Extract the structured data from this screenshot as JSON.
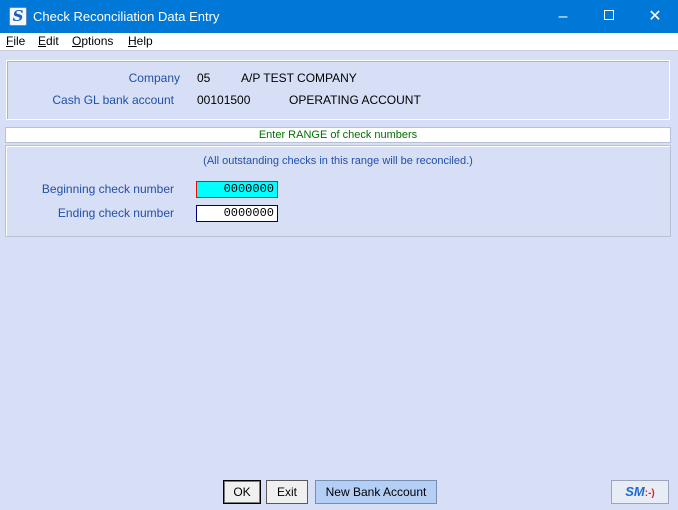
{
  "window": {
    "title": "Check Reconciliation Data Entry",
    "app_icon_letter": "S",
    "min_glyph": "–",
    "close_glyph": "✕"
  },
  "menu": {
    "items": [
      {
        "hotkey": "F",
        "rest": "ile"
      },
      {
        "hotkey": "E",
        "rest": "dit"
      },
      {
        "hotkey": "O",
        "rest": "ptions"
      },
      {
        "hotkey": "H",
        "rest": "elp"
      }
    ]
  },
  "header": {
    "company_label": "Company",
    "company_code": "05",
    "company_name": "A/P TEST COMPANY",
    "bank_label": "Cash GL bank account",
    "bank_code": "00101500",
    "bank_name": "OPERATING ACCOUNT"
  },
  "range": {
    "band_text": "Enter RANGE of check numbers",
    "note": "(All outstanding checks in this range will be reconciled.)",
    "begin_label": "Beginning check number",
    "begin_value": "0000000",
    "end_label": "Ending check number",
    "end_value": "0000000"
  },
  "buttons": {
    "ok": "OK",
    "exit": "Exit",
    "new_bank": "New Bank Account",
    "sm_text": "SM",
    "sm_smiley": ":-)"
  },
  "colors": {
    "title_bar": "#0078d7",
    "body": "#d6dff5",
    "label_text": "#2250a8",
    "band_text": "#007000",
    "active_field": "#00ffff",
    "active_field_border": "#ff0000"
  }
}
